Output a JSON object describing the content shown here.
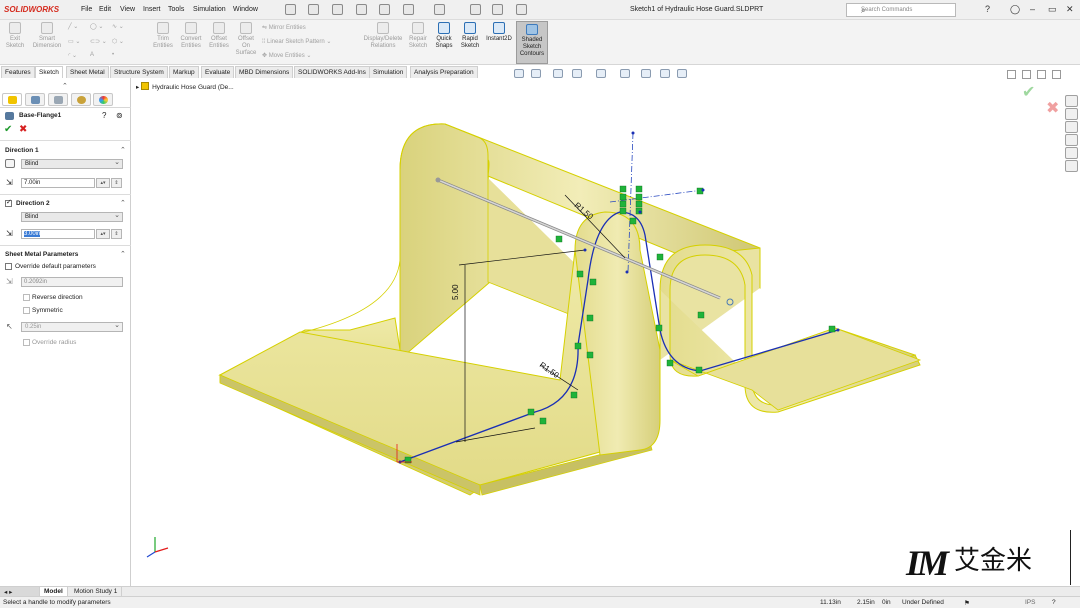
{
  "app": {
    "logo_text": "SOLIDWORKS",
    "menu": [
      "File",
      "Edit",
      "View",
      "Insert",
      "Tools",
      "Simulation",
      "Window"
    ],
    "document_title": "Sketch1 of Hydraulic Hose Guard.SLDPRT",
    "search_placeholder": "Search Commands"
  },
  "toolbar": {
    "exit_sketch": "Exit Sketch",
    "smart_dimension": "Smart Dimension",
    "trim_entities": "Trim Entities",
    "convert_entities": "Convert Entities",
    "offset_entities": "Offset Entities",
    "offset_on_surface": "Offset On Surface",
    "mirror_entities": "Mirror Entities",
    "linear_sketch_pattern": "Linear Sketch Pattern",
    "move_entities": "Move Entities",
    "display_delete_relations": "Display/Delete Relations",
    "repair_sketch": "Repair Sketch",
    "quick_snaps": "Quick Snaps",
    "rapid_sketch": "Rapid Sketch",
    "instant2d": "Instant2D",
    "shaded_sketch_contours": "Shaded Sketch Contours"
  },
  "tabs": [
    "Features",
    "Sketch",
    "Sheet Metal",
    "Structure System",
    "Markup",
    "Evaluate",
    "MBD Dimensions",
    "SOLIDWORKS Add-Ins",
    "Simulation",
    "Analysis Preparation"
  ],
  "active_tab": "Sketch",
  "property_manager": {
    "title": "Base-Flange1",
    "direction1": {
      "label": "Direction 1",
      "end_condition": "Blind",
      "depth": "7.00in"
    },
    "direction2": {
      "label": "Direction 2",
      "end_condition": "Blind",
      "depth": "3.00in"
    },
    "sheet_metal": {
      "label": "Sheet Metal Parameters",
      "override_default": "Override default parameters",
      "thickness": "0.2092in",
      "reverse_direction": "Reverse direction",
      "symmetric": "Symmetric",
      "radius": "0.25in",
      "override_radius": "Override radius"
    }
  },
  "graphics": {
    "tree_item": "Hydraulic Hose Guard (De...",
    "dim_radius_top": "R1.50",
    "dim_height": "5.00",
    "dim_radius_bottom": "R1.50"
  },
  "bottom_tabs": [
    "Model",
    "Motion Study 1"
  ],
  "status": {
    "message": "Select a handle to modify parameters",
    "x": "11.13in",
    "y": "2.15in",
    "z": "0in",
    "state": "Under Defined",
    "units": "IPS"
  },
  "brand": {
    "mark": "IM",
    "text": "艾金米"
  },
  "colors": {
    "accent": "#d52b1e",
    "part_fill": "#e9e49a",
    "part_edge": "#d8d400",
    "sketch": "#1a2fb5",
    "relation": "#1fb33a"
  }
}
